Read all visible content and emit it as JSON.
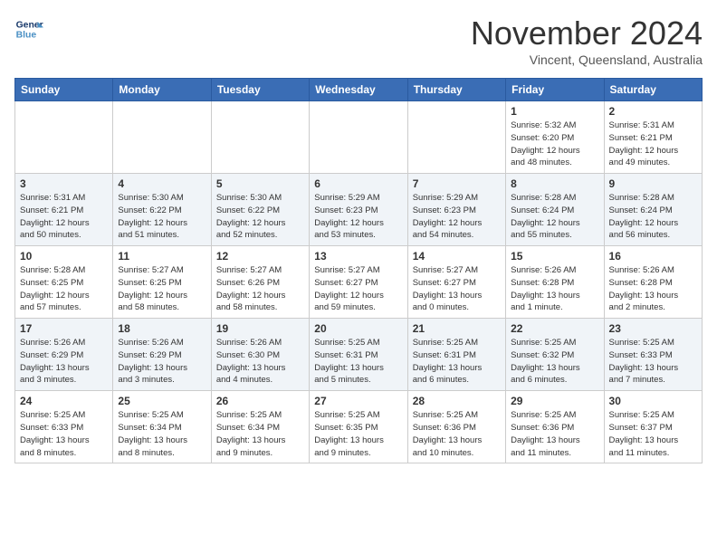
{
  "header": {
    "logo_line1": "General",
    "logo_line2": "Blue",
    "month": "November 2024",
    "location": "Vincent, Queensland, Australia"
  },
  "weekdays": [
    "Sunday",
    "Monday",
    "Tuesday",
    "Wednesday",
    "Thursday",
    "Friday",
    "Saturday"
  ],
  "weeks": [
    [
      {
        "day": "",
        "info": ""
      },
      {
        "day": "",
        "info": ""
      },
      {
        "day": "",
        "info": ""
      },
      {
        "day": "",
        "info": ""
      },
      {
        "day": "",
        "info": ""
      },
      {
        "day": "1",
        "info": "Sunrise: 5:32 AM\nSunset: 6:20 PM\nDaylight: 12 hours\nand 48 minutes."
      },
      {
        "day": "2",
        "info": "Sunrise: 5:31 AM\nSunset: 6:21 PM\nDaylight: 12 hours\nand 49 minutes."
      }
    ],
    [
      {
        "day": "3",
        "info": "Sunrise: 5:31 AM\nSunset: 6:21 PM\nDaylight: 12 hours\nand 50 minutes."
      },
      {
        "day": "4",
        "info": "Sunrise: 5:30 AM\nSunset: 6:22 PM\nDaylight: 12 hours\nand 51 minutes."
      },
      {
        "day": "5",
        "info": "Sunrise: 5:30 AM\nSunset: 6:22 PM\nDaylight: 12 hours\nand 52 minutes."
      },
      {
        "day": "6",
        "info": "Sunrise: 5:29 AM\nSunset: 6:23 PM\nDaylight: 12 hours\nand 53 minutes."
      },
      {
        "day": "7",
        "info": "Sunrise: 5:29 AM\nSunset: 6:23 PM\nDaylight: 12 hours\nand 54 minutes."
      },
      {
        "day": "8",
        "info": "Sunrise: 5:28 AM\nSunset: 6:24 PM\nDaylight: 12 hours\nand 55 minutes."
      },
      {
        "day": "9",
        "info": "Sunrise: 5:28 AM\nSunset: 6:24 PM\nDaylight: 12 hours\nand 56 minutes."
      }
    ],
    [
      {
        "day": "10",
        "info": "Sunrise: 5:28 AM\nSunset: 6:25 PM\nDaylight: 12 hours\nand 57 minutes."
      },
      {
        "day": "11",
        "info": "Sunrise: 5:27 AM\nSunset: 6:25 PM\nDaylight: 12 hours\nand 58 minutes."
      },
      {
        "day": "12",
        "info": "Sunrise: 5:27 AM\nSunset: 6:26 PM\nDaylight: 12 hours\nand 58 minutes."
      },
      {
        "day": "13",
        "info": "Sunrise: 5:27 AM\nSunset: 6:27 PM\nDaylight: 12 hours\nand 59 minutes."
      },
      {
        "day": "14",
        "info": "Sunrise: 5:27 AM\nSunset: 6:27 PM\nDaylight: 13 hours\nand 0 minutes."
      },
      {
        "day": "15",
        "info": "Sunrise: 5:26 AM\nSunset: 6:28 PM\nDaylight: 13 hours\nand 1 minute."
      },
      {
        "day": "16",
        "info": "Sunrise: 5:26 AM\nSunset: 6:28 PM\nDaylight: 13 hours\nand 2 minutes."
      }
    ],
    [
      {
        "day": "17",
        "info": "Sunrise: 5:26 AM\nSunset: 6:29 PM\nDaylight: 13 hours\nand 3 minutes."
      },
      {
        "day": "18",
        "info": "Sunrise: 5:26 AM\nSunset: 6:29 PM\nDaylight: 13 hours\nand 3 minutes."
      },
      {
        "day": "19",
        "info": "Sunrise: 5:26 AM\nSunset: 6:30 PM\nDaylight: 13 hours\nand 4 minutes."
      },
      {
        "day": "20",
        "info": "Sunrise: 5:25 AM\nSunset: 6:31 PM\nDaylight: 13 hours\nand 5 minutes."
      },
      {
        "day": "21",
        "info": "Sunrise: 5:25 AM\nSunset: 6:31 PM\nDaylight: 13 hours\nand 6 minutes."
      },
      {
        "day": "22",
        "info": "Sunrise: 5:25 AM\nSunset: 6:32 PM\nDaylight: 13 hours\nand 6 minutes."
      },
      {
        "day": "23",
        "info": "Sunrise: 5:25 AM\nSunset: 6:33 PM\nDaylight: 13 hours\nand 7 minutes."
      }
    ],
    [
      {
        "day": "24",
        "info": "Sunrise: 5:25 AM\nSunset: 6:33 PM\nDaylight: 13 hours\nand 8 minutes."
      },
      {
        "day": "25",
        "info": "Sunrise: 5:25 AM\nSunset: 6:34 PM\nDaylight: 13 hours\nand 8 minutes."
      },
      {
        "day": "26",
        "info": "Sunrise: 5:25 AM\nSunset: 6:34 PM\nDaylight: 13 hours\nand 9 minutes."
      },
      {
        "day": "27",
        "info": "Sunrise: 5:25 AM\nSunset: 6:35 PM\nDaylight: 13 hours\nand 9 minutes."
      },
      {
        "day": "28",
        "info": "Sunrise: 5:25 AM\nSunset: 6:36 PM\nDaylight: 13 hours\nand 10 minutes."
      },
      {
        "day": "29",
        "info": "Sunrise: 5:25 AM\nSunset: 6:36 PM\nDaylight: 13 hours\nand 11 minutes."
      },
      {
        "day": "30",
        "info": "Sunrise: 5:25 AM\nSunset: 6:37 PM\nDaylight: 13 hours\nand 11 minutes."
      }
    ]
  ]
}
